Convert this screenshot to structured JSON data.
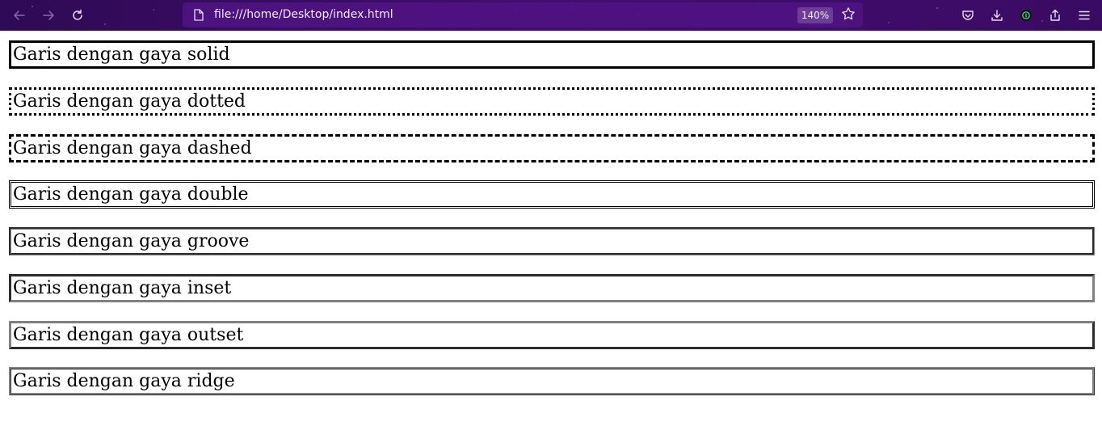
{
  "browser": {
    "url": "file:///home/Desktop/index.html",
    "zoom": "140%",
    "icons": {
      "back": "back-arrow-icon",
      "forward": "forward-arrow-icon",
      "reload": "reload-icon",
      "page": "page-icon",
      "bookmark": "star-icon",
      "pocket": "pocket-icon",
      "downloads": "download-icon",
      "extension": "extension-icon",
      "share": "share-icon",
      "menu": "hamburger-menu-icon"
    },
    "colors": {
      "toolbar": "#3b0b62",
      "urlbar": "#501482"
    }
  },
  "page": {
    "boxes": [
      {
        "style": "solid",
        "text": "Garis dengan gaya solid"
      },
      {
        "style": "dotted",
        "text": "Garis dengan gaya dotted"
      },
      {
        "style": "dashed",
        "text": "Garis dengan gaya dashed"
      },
      {
        "style": "double",
        "text": "Garis dengan gaya double"
      },
      {
        "style": "groove",
        "text": "Garis dengan gaya groove"
      },
      {
        "style": "inset",
        "text": "Garis dengan gaya inset"
      },
      {
        "style": "outset",
        "text": "Garis dengan gaya outset"
      },
      {
        "style": "ridge",
        "text": "Garis dengan gaya ridge"
      }
    ]
  }
}
